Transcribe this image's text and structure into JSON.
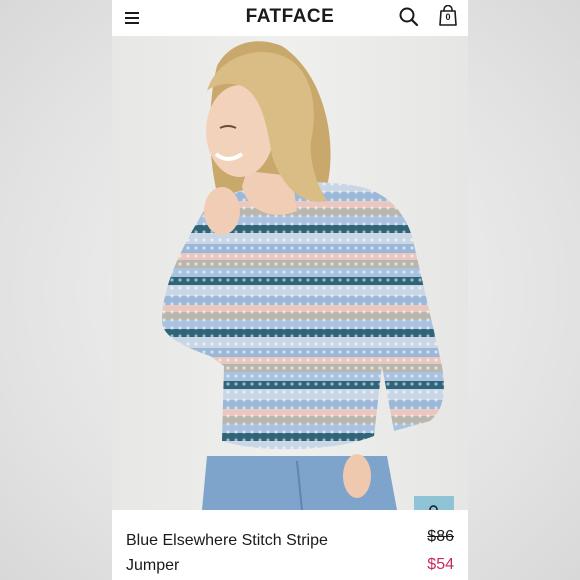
{
  "header": {
    "brand": "FATFACE",
    "bag_count": "0",
    "icons": [
      "menu-icon",
      "search-icon",
      "shopping-bag-icon"
    ]
  },
  "gallery": {
    "slide_count": 6,
    "active_slide": 2,
    "quick_add_icon": "add-to-bag-icon"
  },
  "product": {
    "name_line1": "Blue Elsewhere Stitch Stripe",
    "name_line2": "Jumper",
    "was_price": "$86",
    "price": "$54"
  },
  "colors": {
    "accent_sale": "#c8285e",
    "quick_add_bg": "#8fc3d6",
    "active_dot": "#3f6f8a"
  }
}
